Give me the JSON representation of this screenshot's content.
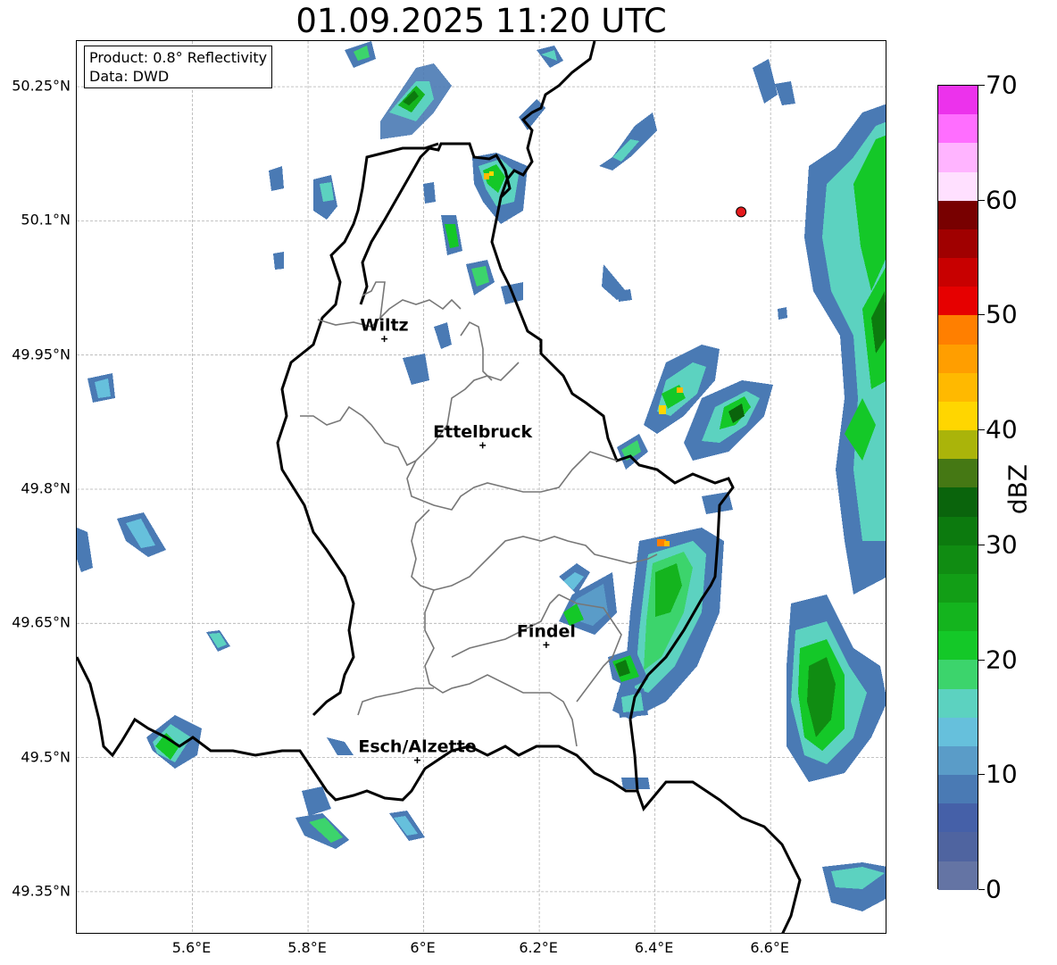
{
  "title": "01.09.2025 11:20 UTC",
  "info": {
    "product": "Product: 0.8° Reflectivity",
    "data": "Data: DWD"
  },
  "axes": {
    "lat_labels": [
      "50.25°N",
      "50.1°N",
      "49.95°N",
      "49.8°N",
      "49.65°N",
      "49.5°N",
      "49.35°N"
    ],
    "lat_values": [
      50.25,
      50.1,
      49.95,
      49.8,
      49.65,
      49.5,
      49.35
    ],
    "lon_labels": [
      "5.6°E",
      "5.8°E",
      "6°E",
      "6.2°E",
      "6.4°E",
      "6.6°E"
    ],
    "lon_values": [
      5.6,
      5.8,
      6.0,
      6.2,
      6.4,
      6.6
    ],
    "lat_range": [
      49.302,
      50.301
    ],
    "lon_range": [
      5.4,
      6.802
    ],
    "grid": true
  },
  "cities": [
    {
      "name": "Wiltz",
      "lat": 49.968,
      "lon": 5.932
    },
    {
      "name": "Ettelbruck",
      "lat": 49.849,
      "lon": 6.102
    },
    {
      "name": "Findel",
      "lat": 49.626,
      "lon": 6.212
    },
    {
      "name": "Esch/Alzette",
      "lat": 49.497,
      "lon": 5.989
    }
  ],
  "marker": {
    "lat": 50.11,
    "lon": 6.549,
    "color": "#e41a1c"
  },
  "colorbar": {
    "label": "dBZ",
    "min": 0,
    "max": 70,
    "tick_values": [
      0,
      10,
      20,
      30,
      40,
      50,
      60,
      70
    ],
    "tick_labels": [
      "0",
      "10",
      "20",
      "30",
      "40",
      "50",
      "60",
      "70"
    ],
    "colors": [
      "#6474a4",
      "#4f64a0",
      "#4560a8",
      "#4a7ab4",
      "#5a9cc8",
      "#66c0dc",
      "#5cd2c0",
      "#3cd46c",
      "#14c828",
      "#14b41e",
      "#129e16",
      "#108c12",
      "#0c7a0e",
      "#0a640c",
      "#457814",
      "#aab40a",
      "#ffd600",
      "#ffb900",
      "#ff9e00",
      "#ff7f00",
      "#e60000",
      "#c80000",
      "#a00000",
      "#780000",
      "#ffe0ff",
      "#ffb4ff",
      "#ff6eff",
      "#ec32ec"
    ]
  },
  "radar_echoes": [
    {
      "lat": 50.22,
      "lon": 5.9,
      "max_dbz": 28
    },
    {
      "lat": 50.26,
      "lon": 5.94,
      "max_dbz": 22
    },
    {
      "lat": 50.14,
      "lon": 6.11,
      "max_dbz": 42
    },
    {
      "lat": 50.085,
      "lon": 6.04,
      "max_dbz": 20
    },
    {
      "lat": 50.04,
      "lon": 6.1,
      "max_dbz": 20
    },
    {
      "lat": 49.9,
      "lon": 6.42,
      "max_dbz": 40
    },
    {
      "lat": 49.88,
      "lon": 6.55,
      "max_dbz": 28
    },
    {
      "lat": 49.7,
      "lon": 6.43,
      "max_dbz": 45
    },
    {
      "lat": 49.62,
      "lon": 6.44,
      "max_dbz": 25
    },
    {
      "lat": 49.55,
      "lon": 6.68,
      "max_dbz": 28
    },
    {
      "lat": 50.0,
      "lon": 6.76,
      "max_dbz": 28
    },
    {
      "lat": 49.52,
      "lon": 5.56,
      "max_dbz": 22
    }
  ]
}
